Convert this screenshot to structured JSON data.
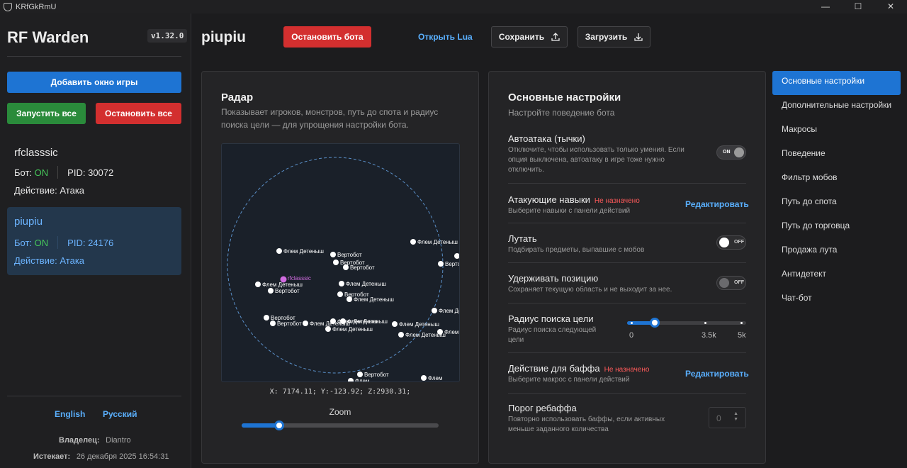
{
  "window": {
    "title": "KRfGkRmU",
    "minimize": "—",
    "maximize": "☐",
    "close": "✕"
  },
  "sidebar": {
    "brand": "RF Warden",
    "version": "v1.32.0",
    "add_window": "Добавить окно игры",
    "start_all": "Запустить все",
    "stop_all": "Остановить все",
    "windows": [
      {
        "name": "rfclasssic",
        "bot_label": "Бот:",
        "bot_status": "ON",
        "pid_label": "PID:",
        "pid": "30072",
        "action_label": "Действие:",
        "action": "Атака"
      },
      {
        "name": "piupiu",
        "bot_label": "Бот:",
        "bot_status": "ON",
        "pid_label": "PID:",
        "pid": "24176",
        "action_label": "Действие:",
        "action": "Атака"
      }
    ],
    "lang_en": "English",
    "lang_ru": "Русский",
    "owner_label": "Владелец:",
    "owner": "Diantro",
    "expires_label": "Истекает:",
    "expires": "26 декабря 2025 16:54:31"
  },
  "header": {
    "title": "piupiu",
    "stop_bot": "Остановить бота",
    "open_lua": "Открыть Lua",
    "save": "Сохранить",
    "load": "Загрузить"
  },
  "radar": {
    "title": "Радар",
    "description": "Показывает игроков, монстров, путь до спота и радиус поиска цели — для упрощения настройки бота.",
    "coords": "X: 7174.11; Y:-123.92; Z:2930.31;",
    "zoom_label": "Zoom",
    "zoom_value": 0.19,
    "player": {
      "name": "rfclasssic",
      "color": "#d16be0"
    },
    "entities": [
      {
        "label": "Флем Детеныш"
      },
      {
        "label": "Вертобот"
      },
      {
        "label": "Вертобот"
      },
      {
        "label": "Вертобот"
      },
      {
        "label": "Флем Детеныш"
      },
      {
        "label": "Флем Детеныш"
      },
      {
        "label": "Вертобот"
      },
      {
        "label": "Флем Детеныш"
      },
      {
        "label": "Флем Детеныш"
      },
      {
        "label": "Вертобот"
      },
      {
        "label": "Вертобот"
      },
      {
        "label": "Флем Детеныш"
      },
      {
        "label": "Вертобот"
      },
      {
        "label": "Флем Детеныш"
      },
      {
        "label": "Вертобот"
      },
      {
        "label": "Флем Детеныш"
      },
      {
        "label": "Флем Детеныш"
      },
      {
        "label": "Флем Детеныш"
      },
      {
        "label": "Флем Детеныш"
      },
      {
        "label": "Флем Детеныш"
      },
      {
        "label": "Флем Детеныш"
      },
      {
        "label": "Флем Детеныш"
      },
      {
        "label": "Вертобот"
      },
      {
        "label": "Флем"
      },
      {
        "label": "Флем"
      },
      {
        "label": ""
      }
    ]
  },
  "settings": {
    "title": "Основные настройки",
    "subtitle": "Настройте поведение бота",
    "autoattack": {
      "title": "Автоатака (тычки)",
      "desc": "Отключите, чтобы использовать только умения. Если опция выключена, автоатаку в игре тоже нужно отключить.",
      "state": "ON"
    },
    "skills": {
      "title": "Атакующие навыки",
      "badge": "Не назначено",
      "desc": "Выберите навыки с панели действий",
      "edit": "Редактировать"
    },
    "loot": {
      "title": "Лутать",
      "desc": "Подбирать предметы, выпавшие с мобов",
      "state": "OFF"
    },
    "hold": {
      "title": "Удерживать позицию",
      "desc": "Сохраняет текущую область и не выходит за нее.",
      "state": "OFF"
    },
    "radius": {
      "title": "Радиус поиска цели",
      "desc": "Радиус поиска следующей цели",
      "min": "0",
      "mid": "3.5k",
      "max": "5k",
      "value_fraction": 0.23
    },
    "buff": {
      "title": "Действие для баффа",
      "badge": "Не назначено",
      "desc": "Выберите макрос с панели действий",
      "edit": "Редактировать"
    },
    "rebuff": {
      "title": "Порог ребаффа",
      "desc": "Повторно использовать баффы, если активных меньше заданного количества",
      "value": "0"
    }
  },
  "nav": [
    "Основные настройки",
    "Дополнительные настройки",
    "Макросы",
    "Поведение",
    "Фильтр мобов",
    "Путь до спота",
    "Путь до торговца",
    "Продажа лута",
    "Антидетект",
    "Чат-бот"
  ],
  "colors": {
    "accent": "#1e74d3",
    "danger": "#d32f2f",
    "success": "#2a8b3b",
    "link": "#5ab0ff"
  }
}
